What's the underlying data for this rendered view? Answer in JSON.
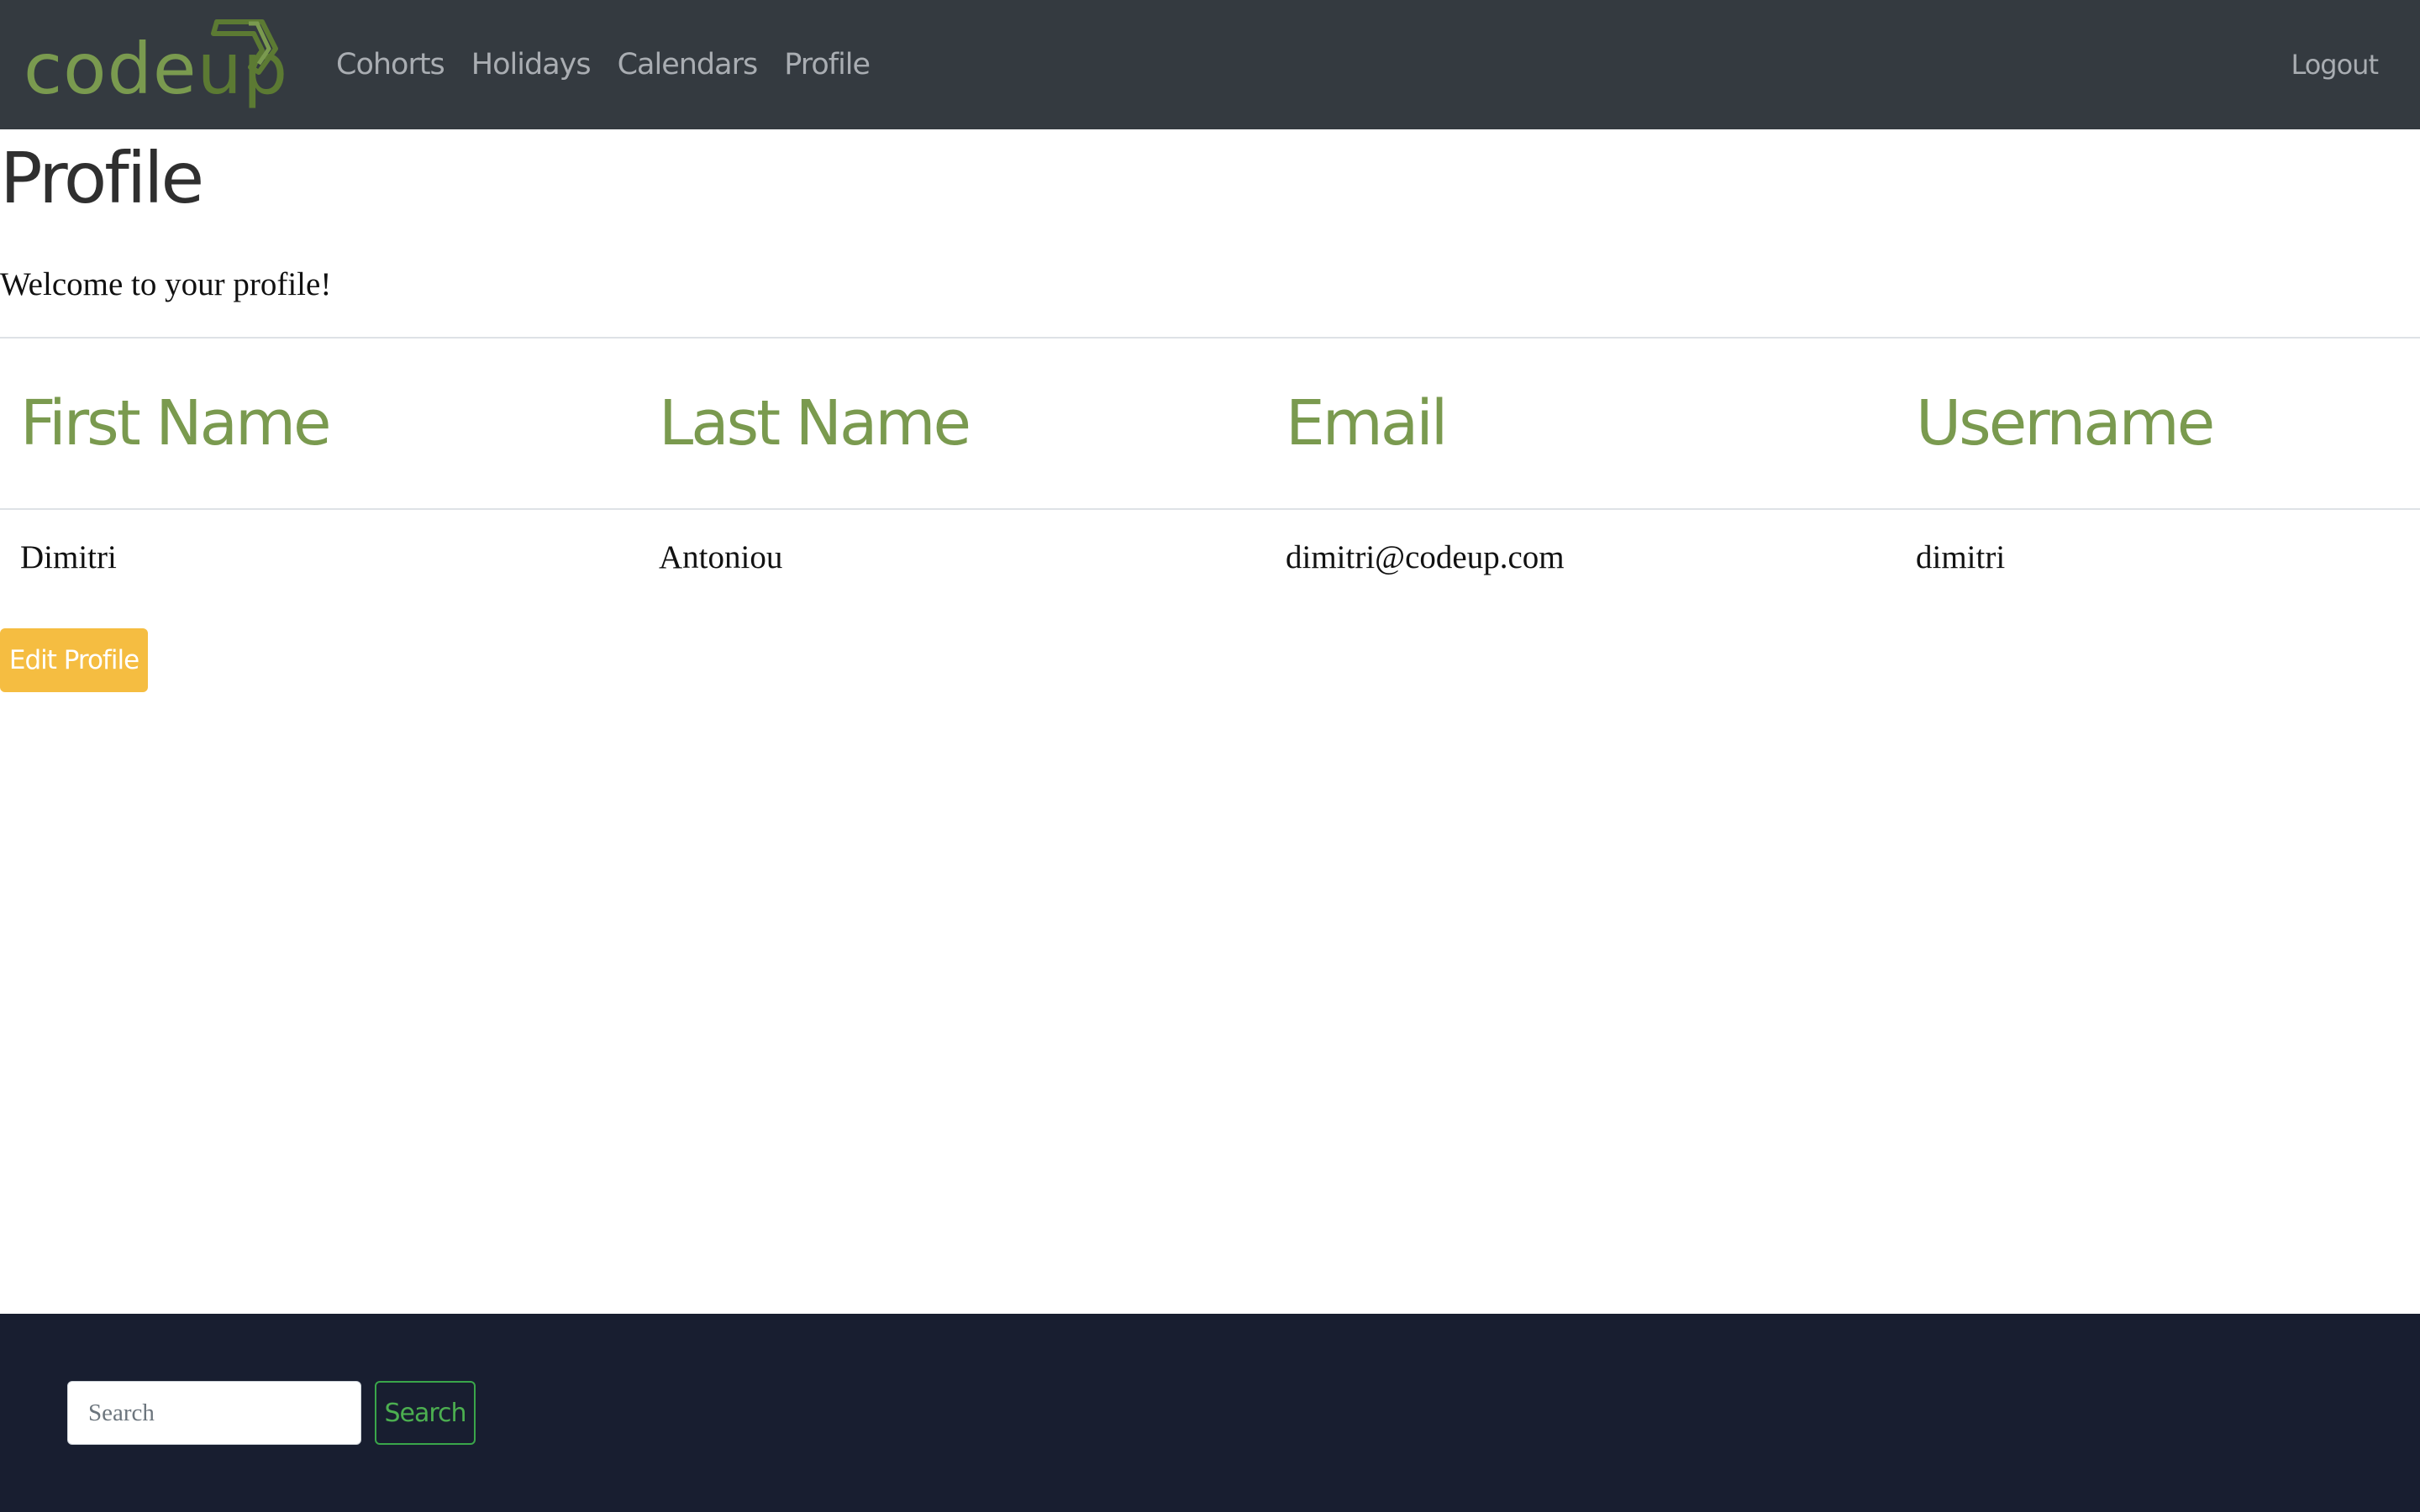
{
  "brand": {
    "code_text": "code",
    "up_text": "up",
    "colors": {
      "code": "#7a9a4f",
      "up": "#5c7a33"
    }
  },
  "nav": {
    "links": [
      "Cohorts",
      "Holidays",
      "Calendars",
      "Profile"
    ],
    "logout": "Logout",
    "background": "#343a40"
  },
  "main": {
    "title": "Profile",
    "welcome": "Welcome to your profile!",
    "table": {
      "headers": [
        "First Name",
        "Last Name",
        "Email",
        "Username"
      ],
      "rows": [
        [
          "Dimitri",
          "Antoniou",
          "dimitri@codeup.com",
          "dimitri"
        ]
      ]
    },
    "edit_button": "Edit Profile",
    "colors": {
      "header_text": "#7a9a4f",
      "edit_button": "#f5bd41"
    }
  },
  "footer": {
    "search_placeholder": "Search",
    "search_value": "",
    "search_button": "Search",
    "background": "#181e30",
    "button_color": "#3aa64a"
  }
}
